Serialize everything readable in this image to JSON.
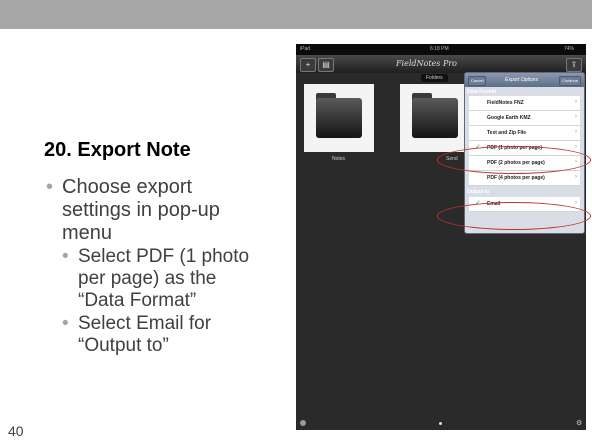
{
  "slide": {
    "title": "20. Export Note",
    "bullet1": "Choose export settings in pop-up menu",
    "sub1": "Select PDF (1 photo per page) as the “Data Format”",
    "sub2": "Select Email for “Output to”",
    "page_number": "40"
  },
  "device": {
    "status_left": "iPad",
    "status_time": "6:18 PM",
    "status_right": "74%",
    "app_logo": "FieldNotes Pro",
    "folders_tab": "Folders",
    "folders": [
      "Notes",
      "Send"
    ],
    "popover": {
      "cancel": "Cancel",
      "title": "Export Options",
      "continue": "Continue",
      "section_format": "Data Format",
      "options": [
        "FieldNotes FNZ",
        "Google Earth KMZ",
        "Text and Zip File",
        "PDF (1 photo per page)",
        "PDF (2 photos per page)",
        "PDF (4 photos per page)"
      ],
      "selected_format": "PDF (1 photo per page)",
      "section_output": "Output to",
      "output_option": "Email"
    }
  },
  "colors": {
    "top_bar": "#a7a7a7",
    "callout": "#c42f2f",
    "check": "#2f9a2f"
  }
}
